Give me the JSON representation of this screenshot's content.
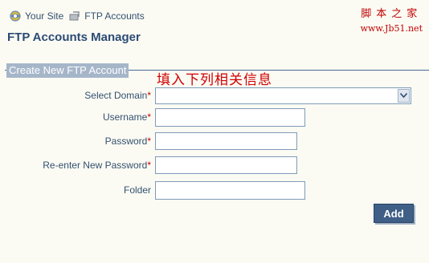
{
  "breadcrumb": {
    "items": [
      {
        "label": "Your Site",
        "icon": "site-icon"
      },
      {
        "label": "FTP Accounts",
        "icon": "ftp-icon"
      }
    ]
  },
  "watermark": {
    "line1": "脚本之家",
    "line2": "www.Jb51.net"
  },
  "page": {
    "title": "FTP Accounts Manager"
  },
  "section": {
    "title": "Create New FTP Account",
    "annotation": "填入下列相关信息"
  },
  "form": {
    "required_mark": "*",
    "fields": [
      {
        "label": "Select Domain",
        "required": true,
        "type": "select",
        "value": ""
      },
      {
        "label": "Username",
        "required": true,
        "type": "text",
        "value": ""
      },
      {
        "label": "Password",
        "required": true,
        "type": "password",
        "value": ""
      },
      {
        "label": "Re-enter New Password",
        "required": true,
        "type": "password",
        "value": ""
      },
      {
        "label": "Folder",
        "required": false,
        "type": "text",
        "value": ""
      }
    ],
    "submit_label": "Add"
  },
  "colors": {
    "accent": "#3f5f86",
    "required": "#cc0000",
    "annotation": "#d00000",
    "section_bg": "#a6b6c9"
  }
}
